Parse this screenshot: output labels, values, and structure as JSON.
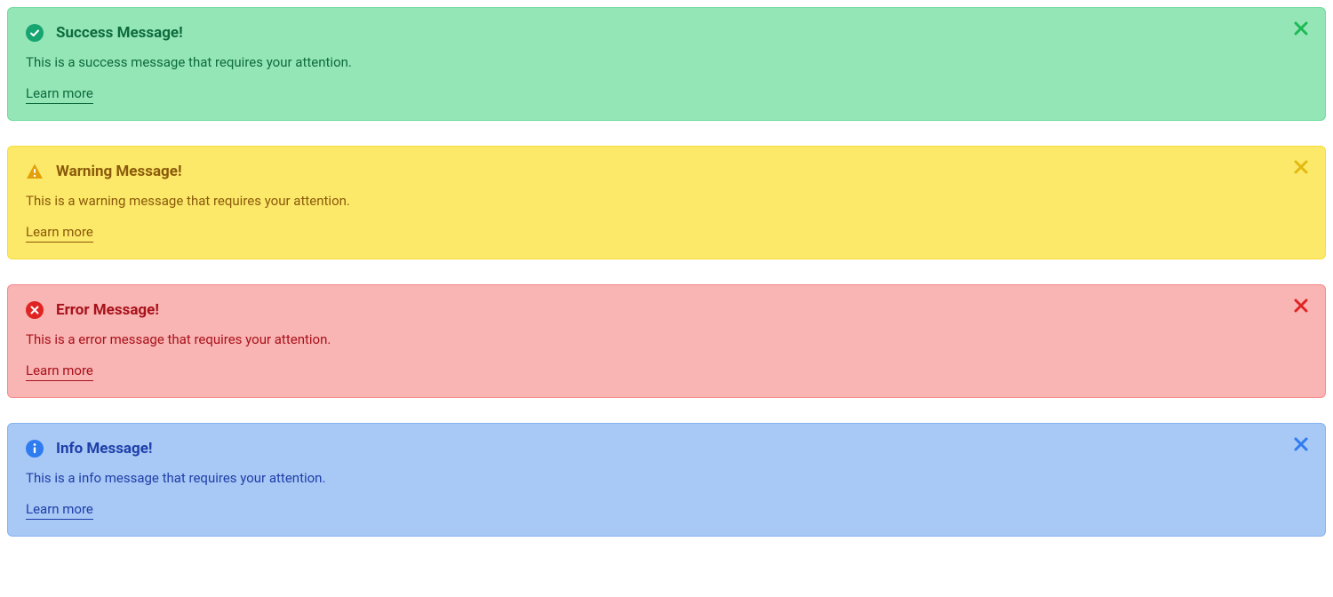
{
  "alerts": {
    "success": {
      "title": "Success Message!",
      "body": "This is a success message that requires your attention.",
      "link": "Learn more"
    },
    "warning": {
      "title": "Warning Message!",
      "body": "This is a warning message that requires your attention.",
      "link": "Learn more"
    },
    "error": {
      "title": "Error Message!",
      "body": "This is a error message that requires your attention.",
      "link": "Learn more"
    },
    "info": {
      "title": "Info Message!",
      "body": "This is a info message that requires your attention.",
      "link": "Learn more"
    }
  }
}
